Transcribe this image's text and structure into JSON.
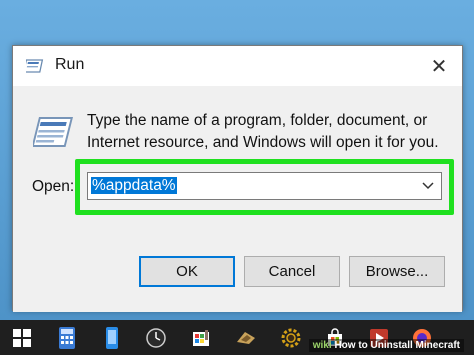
{
  "dialog": {
    "title": "Run",
    "close_glyph": "✕",
    "description": "Type the name of a program, folder, document, or Internet resource, and Windows will open it for you.",
    "open_label": "Open:",
    "open_value": "%appdata%",
    "buttons": {
      "ok": "OK",
      "cancel": "Cancel",
      "browse": "Browse..."
    }
  },
  "watermark": {
    "brand": "wiki",
    "text": "How to Uninstall Minecraft"
  },
  "taskbar": {
    "icons": [
      "windows-start-icon",
      "calculator-icon",
      "phone-icon",
      "clock-icon",
      "paint-icon",
      "game-icon",
      "settings-gear-icon",
      "store-icon",
      "media-icon",
      "firefox-icon"
    ]
  },
  "colors": {
    "highlight": "#1fe01f",
    "selection": "#0078d7",
    "taskbar": "#1f1f1f"
  }
}
